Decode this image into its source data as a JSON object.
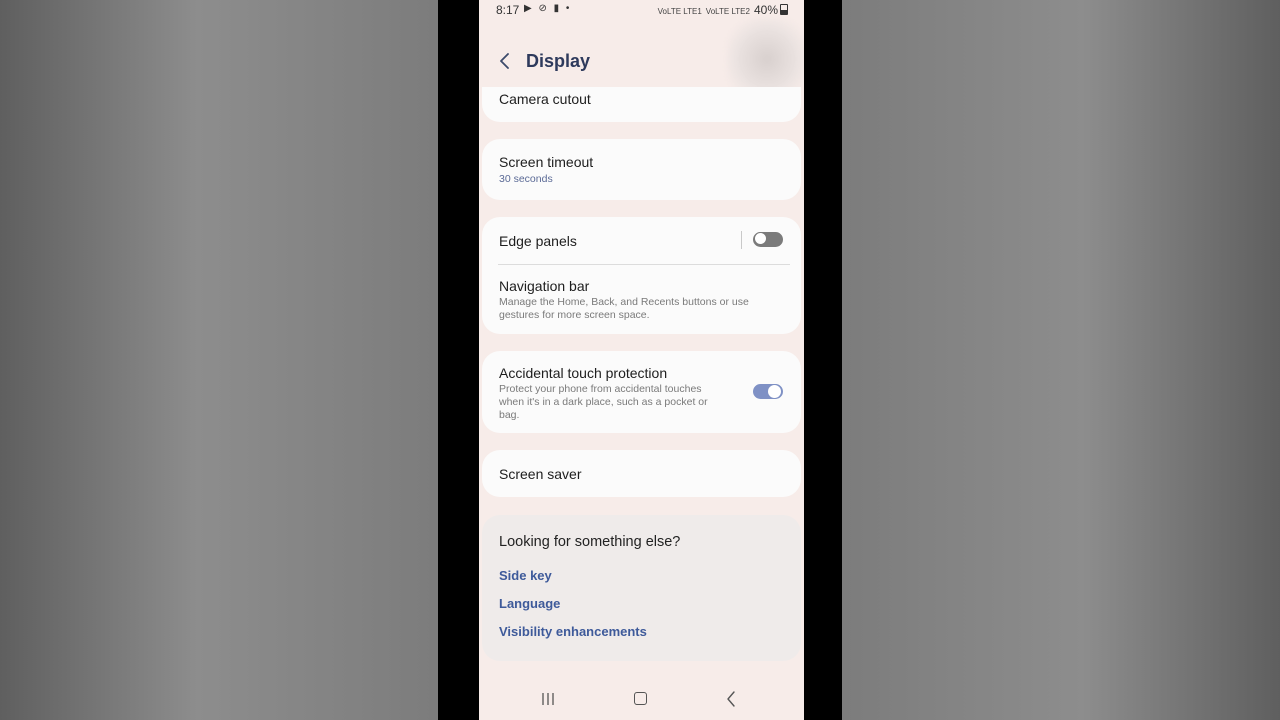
{
  "status_bar": {
    "time": "8:17",
    "left_icons": "▶ ⊘ ▮ •",
    "network_1": "VoLTE LTE1",
    "network_2": "VoLTE LTE2",
    "battery": "40%"
  },
  "header": {
    "title": "Display",
    "back_icon": "‹"
  },
  "settings": {
    "camera_cutout": {
      "title": "Camera cutout"
    },
    "screen_timeout": {
      "title": "Screen timeout",
      "value": "30 seconds"
    },
    "edge_panels": {
      "title": "Edge panels",
      "enabled": false
    },
    "navigation_bar": {
      "title": "Navigation bar",
      "description": "Manage the Home, Back, and Recents buttons or use gestures for more screen space."
    },
    "accidental_touch": {
      "title": "Accidental touch protection",
      "description": "Protect your phone from accidental touches when it's in a dark place, such as a pocket or bag.",
      "enabled": true
    },
    "screen_saver": {
      "title": "Screen saver"
    }
  },
  "suggestions": {
    "title": "Looking for something else?",
    "links": [
      "Side key",
      "Language",
      "Visibility enhancements"
    ]
  },
  "nav": {
    "recents_icon": "|||",
    "back_icon": "‹"
  },
  "colors": {
    "accent": "#3e5a9a",
    "toggle_on": "#7f91c5",
    "screen_bg": "#f7ece9"
  }
}
